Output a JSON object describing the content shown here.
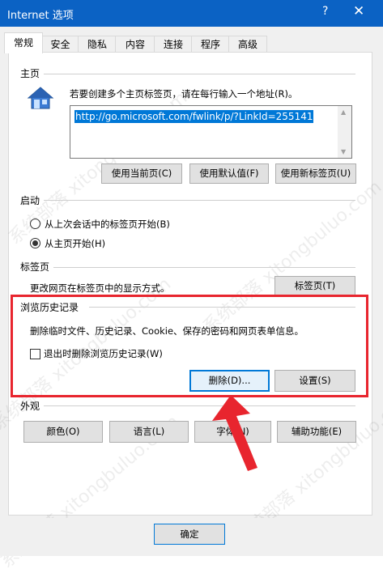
{
  "window": {
    "title": "Internet 选项",
    "help": "?",
    "close": "✕"
  },
  "tabs": [
    "常规",
    "安全",
    "隐私",
    "内容",
    "连接",
    "程序",
    "高级"
  ],
  "homepage": {
    "section": "主页",
    "instruction": "若要创建多个主页标签页，请在每行输入一个地址(R)。",
    "url": "http://go.microsoft.com/fwlink/p/?LinkId=255141",
    "buttons": [
      "使用当前页(C)",
      "使用默认值(F)",
      "使用新标签页(U)"
    ]
  },
  "startup": {
    "section": "启动",
    "options": [
      "从上次会话中的标签页开始(B)",
      "从主页开始(H)"
    ],
    "selected_index": 1
  },
  "tabs_section": {
    "section": "标签页",
    "description": "更改网页在标签页中的显示方式。",
    "button": "标签页(T)"
  },
  "history": {
    "section": "浏览历史记录",
    "description": "删除临时文件、历史记录、Cookie、保存的密码和网页表单信息。",
    "checkbox_label": "退出时删除浏览历史记录(W)",
    "checkbox_checked": false,
    "delete_button": "删除(D)...",
    "settings_button": "设置(S)"
  },
  "appearance": {
    "section": "外观",
    "buttons": [
      "颜色(O)",
      "语言(L)",
      "字体(N)",
      "辅助功能(E)"
    ]
  },
  "footer": {
    "ok_button": "确定"
  },
  "colors": {
    "title_bar": "#0b62c4",
    "highlight": "#e8252e",
    "selection": "#0078d7"
  },
  "icons": {
    "home": "home-icon",
    "arrow": "red-arrow-annotation"
  }
}
